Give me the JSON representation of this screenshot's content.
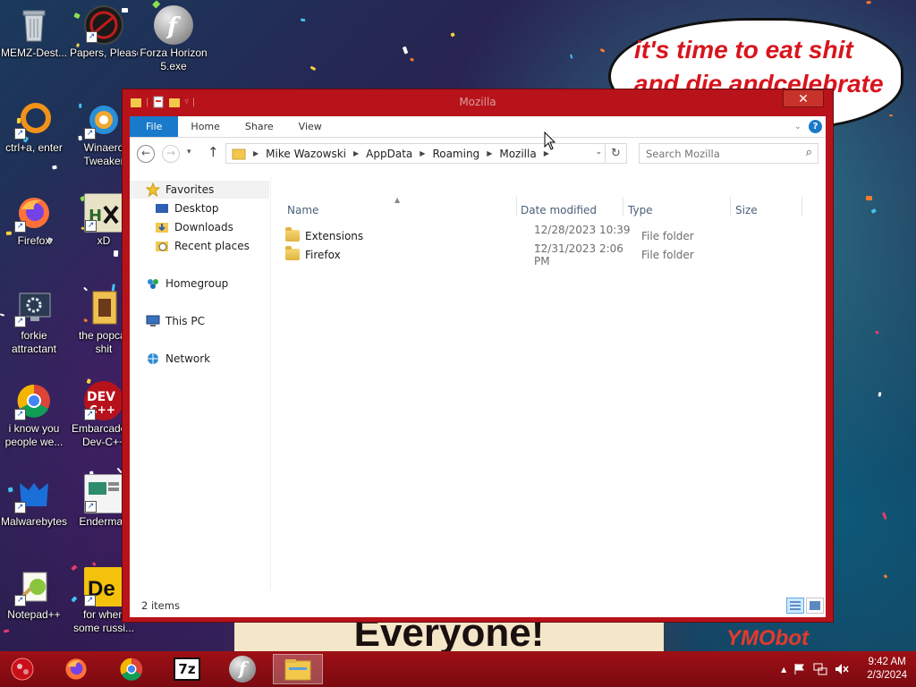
{
  "desktop": {
    "icons": [
      {
        "label": "MEMZ-Dest..."
      },
      {
        "label": "Papers, Please"
      },
      {
        "label": "Forza Horizon 5.exe"
      },
      {
        "label": "ctrl+a, enter"
      },
      {
        "label": "Winaero Tweaker"
      },
      {
        "label": "Firefox"
      },
      {
        "label": "xD"
      },
      {
        "label": "forkie attractant"
      },
      {
        "label": "the popcat shit"
      },
      {
        "label": "i know you people we..."
      },
      {
        "label": "Embarcadero Dev-C++"
      },
      {
        "label": "Malwarebytes"
      },
      {
        "label": "Enderman"
      },
      {
        "label": "Notepad++"
      },
      {
        "label": "for when some russi..."
      }
    ],
    "wallpaper": {
      "speech_line1": "it's time to eat shit",
      "speech_line2": "and die andcelebrate",
      "banner": "Everyone!",
      "watermark": "YMObot",
      "text_color": "#d8141d"
    }
  },
  "window": {
    "title": "Mozilla",
    "close_label": "✕",
    "accent": "#b8121a",
    "ribbon": {
      "file": "File",
      "home": "Home",
      "share": "Share",
      "view": "View",
      "help": "?"
    },
    "breadcrumb": [
      "Mike Wazowski",
      "AppData",
      "Roaming",
      "Mozilla"
    ],
    "search_placeholder": "Search Mozilla",
    "nav_pane": {
      "favorites": "Favorites",
      "desktop": "Desktop",
      "downloads": "Downloads",
      "recent": "Recent places",
      "homegroup": "Homegroup",
      "this_pc": "This PC",
      "network": "Network"
    },
    "columns": {
      "name": "Name",
      "date": "Date modified",
      "type": "Type",
      "size": "Size"
    },
    "files": [
      {
        "name": "Extensions",
        "date": "12/28/2023 10:39 ...",
        "type": "File folder",
        "size": ""
      },
      {
        "name": "Firefox",
        "date": "12/31/2023 2:06 PM",
        "type": "File folder",
        "size": ""
      }
    ],
    "status": "2 items"
  },
  "taskbar": {
    "apps": [
      "start-orb",
      "firefox",
      "chrome",
      "7-zip",
      "flash-player",
      "file-explorer"
    ],
    "seven_zip_label": "7z",
    "flash_label": "f",
    "time": "9:42 AM",
    "date": "2/3/2024",
    "tray_up": "▲"
  }
}
